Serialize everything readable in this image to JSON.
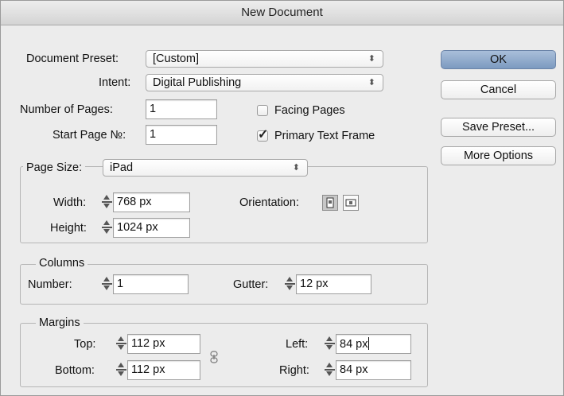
{
  "window": {
    "title": "New Document"
  },
  "document_preset": {
    "label": "Document Preset:",
    "value": "[Custom]"
  },
  "intent": {
    "label": "Intent:",
    "value": "Digital Publishing"
  },
  "number_of_pages": {
    "label": "Number of Pages:",
    "value": "1"
  },
  "start_page": {
    "label": "Start Page №:",
    "value": "1"
  },
  "facing_pages": {
    "label": "Facing Pages",
    "checked": false
  },
  "primary_text_frame": {
    "label": "Primary Text Frame",
    "checked": true
  },
  "page_size": {
    "legend": "Page Size:",
    "value": "iPad",
    "width_label": "Width:",
    "width_value": "768 px",
    "height_label": "Height:",
    "height_value": "1024 px",
    "orientation_label": "Orientation:",
    "orientation_selected": "portrait"
  },
  "columns": {
    "legend": "Columns",
    "number_label": "Number:",
    "number_value": "1",
    "gutter_label": "Gutter:",
    "gutter_value": "12 px"
  },
  "margins": {
    "legend": "Margins",
    "top_label": "Top:",
    "top_value": "112 px",
    "bottom_label": "Bottom:",
    "bottom_value": "112 px",
    "left_label": "Left:",
    "left_value": "84 px",
    "right_label": "Right:",
    "right_value": "84 px"
  },
  "buttons": {
    "ok": "OK",
    "cancel": "Cancel",
    "save_preset": "Save Preset...",
    "more_options": "More Options"
  },
  "icons": {
    "popup_arrows": "updown-arrows-icon",
    "spinner": "stepper-icon",
    "portrait": "portrait-orientation-icon",
    "landscape": "landscape-orientation-icon",
    "chain": "chain-link-icon",
    "checkmark": "checkmark-icon"
  },
  "colors": {
    "default_button": "#8fa9cc",
    "window_bg": "#ececec"
  }
}
